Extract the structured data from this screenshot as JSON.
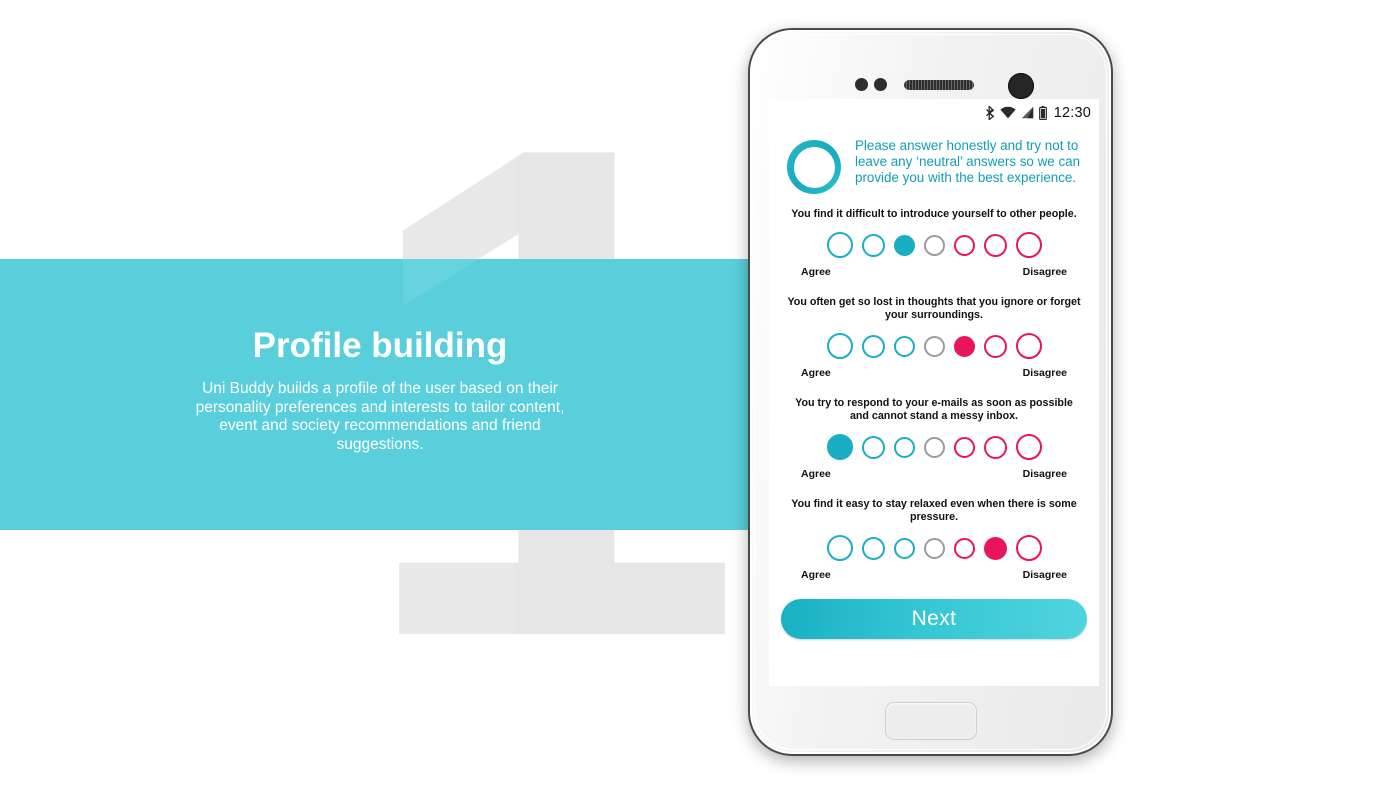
{
  "promo": {
    "numeral": "1",
    "title": "Profile building",
    "body": "Uni Buddy builds a profile of the user based on their personality preferences and interests to tailor content, event and society recommendations and friend suggestions.",
    "band_color": "#58cfdb",
    "numeral_color": "#e6e6e6",
    "text_color": "#ffffff"
  },
  "phone": {
    "status_bar": {
      "bluetooth_icon": "bluetooth-icon",
      "wifi_icon": "wifi-icon",
      "signal_icon": "signal-icon",
      "battery_icon": "battery-icon",
      "time": "12:30"
    },
    "hardware": {
      "sensor_icon": "proximity-sensor-icon",
      "speaker_icon": "earpiece-speaker-icon",
      "camera_icon": "front-camera-icon",
      "home_button": "home-button"
    }
  },
  "screen": {
    "info": {
      "ring_icon": "info-ring-icon",
      "text": "Please answer honestly and try not to leave any ‘neutral’ answers so we can provide you with the best experience."
    },
    "scale": {
      "agree_label": "Agree",
      "disagree_label": "Disagree",
      "agree_color": "#1aaec4",
      "disagree_color": "#e8155c",
      "neutral_color": "#9b9b9b"
    },
    "questions": [
      {
        "text": "You find it difficult to introduce yourself to other people.",
        "selected_index": 2,
        "options": [
          {
            "size": 26,
            "tone": "agree",
            "selected": false
          },
          {
            "size": 23,
            "tone": "agree",
            "selected": false
          },
          {
            "size": 21,
            "tone": "agree",
            "selected": true
          },
          {
            "size": 21,
            "tone": "neutral",
            "selected": false
          },
          {
            "size": 21,
            "tone": "disagree",
            "selected": false
          },
          {
            "size": 23,
            "tone": "disagree",
            "selected": false
          },
          {
            "size": 26,
            "tone": "disagree",
            "selected": false
          }
        ]
      },
      {
        "text": "You often get so lost in thoughts that you ignore or forget your surroundings.",
        "selected_index": 4,
        "options": [
          {
            "size": 26,
            "tone": "agree",
            "selected": false
          },
          {
            "size": 23,
            "tone": "agree",
            "selected": false
          },
          {
            "size": 21,
            "tone": "agree",
            "selected": false
          },
          {
            "size": 21,
            "tone": "neutral",
            "selected": false
          },
          {
            "size": 21,
            "tone": "disagree",
            "selected": true
          },
          {
            "size": 23,
            "tone": "disagree",
            "selected": false
          },
          {
            "size": 26,
            "tone": "disagree",
            "selected": false
          }
        ]
      },
      {
        "text": "You try to respond to your e-mails as soon as possible and cannot stand a messy inbox.",
        "selected_index": 0,
        "options": [
          {
            "size": 26,
            "tone": "agree",
            "selected": true
          },
          {
            "size": 23,
            "tone": "agree",
            "selected": false
          },
          {
            "size": 21,
            "tone": "agree",
            "selected": false
          },
          {
            "size": 21,
            "tone": "neutral",
            "selected": false
          },
          {
            "size": 21,
            "tone": "disagree",
            "selected": false
          },
          {
            "size": 23,
            "tone": "disagree",
            "selected": false
          },
          {
            "size": 26,
            "tone": "disagree",
            "selected": false
          }
        ]
      },
      {
        "text": "You find it easy to stay relaxed even when there is some pressure.",
        "selected_index": 5,
        "options": [
          {
            "size": 26,
            "tone": "agree",
            "selected": false
          },
          {
            "size": 23,
            "tone": "agree",
            "selected": false
          },
          {
            "size": 21,
            "tone": "agree",
            "selected": false
          },
          {
            "size": 21,
            "tone": "neutral",
            "selected": false
          },
          {
            "size": 21,
            "tone": "disagree",
            "selected": false
          },
          {
            "size": 23,
            "tone": "disagree",
            "selected": true
          },
          {
            "size": 26,
            "tone": "disagree",
            "selected": false
          }
        ]
      }
    ],
    "next_button": {
      "label": "Next",
      "gradient_start": "#19b0c4",
      "gradient_end": "#4fd4de"
    }
  }
}
